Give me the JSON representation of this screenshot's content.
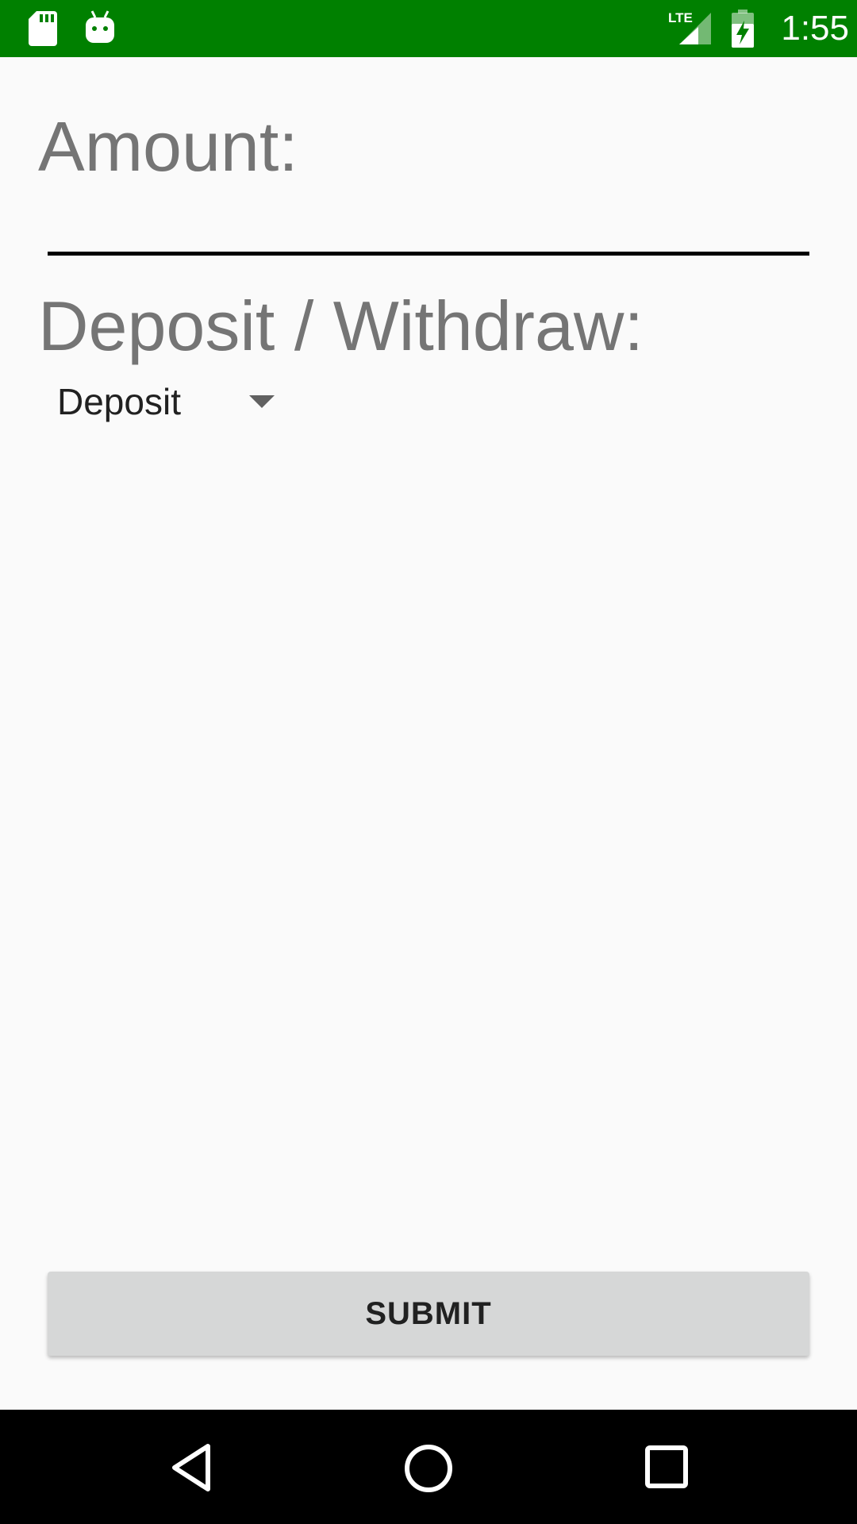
{
  "status_bar": {
    "time": "1:55",
    "network": "LTE",
    "background_color": "#008000",
    "icons": [
      "sd-card-icon",
      "android-icon",
      "lte-signal-icon",
      "battery-charging-icon"
    ]
  },
  "form": {
    "amount_label": "Amount:",
    "amount_value": "",
    "deposit_withdraw_label": "Deposit / Withdraw:",
    "transaction_type_selected": "Deposit"
  },
  "submit_button_label": "SUBMIT",
  "nav_bar": {
    "icons": [
      "back-icon",
      "home-icon",
      "recents-icon"
    ]
  }
}
